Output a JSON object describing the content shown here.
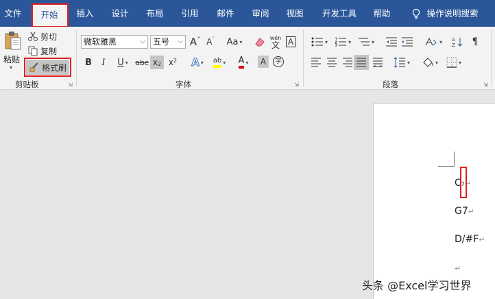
{
  "tabs": {
    "file": "文件",
    "home": "开始",
    "insert": "插入",
    "design": "设计",
    "layout": "布局",
    "references": "引用",
    "mailings": "邮件",
    "review": "审阅",
    "view": "视图",
    "developer": "开发工具",
    "help": "帮助",
    "tell_me": "操作说明搜索"
  },
  "clipboard": {
    "paste": "粘贴",
    "cut": "剪切",
    "copy": "复制",
    "format_painter": "格式刷",
    "group_label": "剪贴板"
  },
  "font": {
    "font_name": "微软雅黑",
    "font_size": "五号",
    "grow": "A",
    "shrink": "A",
    "case": "Aa",
    "phonetic_top": "wén",
    "phonetic_bottom": "文",
    "border_char": "A",
    "bold": "B",
    "italic": "I",
    "underline": "U",
    "strike": "abc",
    "subscript": "x",
    "sub_mark": "2",
    "superscript": "x",
    "sup_mark": "2",
    "effects": "A",
    "highlight": "ab",
    "font_color": "A",
    "shading": "A",
    "enclose": "字",
    "group_label": "字体"
  },
  "paragraph": {
    "group_label": "段落"
  },
  "document": {
    "line1": "C",
    "line1_sub": "7",
    "line2": "G7",
    "line3": "D/#F",
    "mark": "↵"
  },
  "watermark": "头条 @Excel学习世界",
  "colors": {
    "accent": "#2b579a",
    "highlight_red": "#e0201f",
    "underline_red": "#e00000",
    "highlight_yellow": "#ffff00"
  }
}
